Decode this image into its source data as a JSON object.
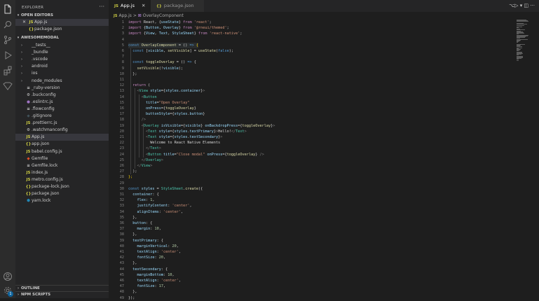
{
  "activity_bar": {
    "icons": [
      "explorer-icon",
      "search-icon",
      "source-control-icon",
      "run-debug-icon",
      "extensions-icon",
      "gitlens-icon",
      "accounts-icon",
      "settings-icon"
    ],
    "settings_badge": "1"
  },
  "sidebar": {
    "title": "EXPLORER",
    "more": "···",
    "open_editors": {
      "label": "OPEN EDITORS",
      "items": [
        {
          "icon": "JS",
          "icon_color": "#cbcb41",
          "name": "App.js",
          "hint": "",
          "close": "✕"
        },
        {
          "icon": "{}",
          "icon_color": "#cbcb41",
          "name": "package.json",
          "hint": "",
          "close": ""
        }
      ]
    },
    "project": {
      "label": "AWESOMEMODAL",
      "items": [
        {
          "chev": "›",
          "icon": "",
          "icon_color": "#cccccc",
          "name": "__tests__"
        },
        {
          "chev": "›",
          "icon": "",
          "icon_color": "#cccccc",
          "name": "_bundle"
        },
        {
          "chev": "›",
          "icon": "",
          "icon_color": "#cccccc",
          "name": ".vscode"
        },
        {
          "chev": "›",
          "icon": "",
          "icon_color": "#cccccc",
          "name": "android"
        },
        {
          "chev": "›",
          "icon": "",
          "icon_color": "#cccccc",
          "name": "ios"
        },
        {
          "chev": "›",
          "icon": "",
          "icon_color": "#cccccc",
          "name": "node_modules"
        },
        {
          "chev": "",
          "icon": "≡",
          "icon_color": "#cccccc",
          "name": "_ruby-version"
        },
        {
          "chev": "",
          "icon": "⚙",
          "icon_color": "#cccccc",
          "name": ".buckconfig"
        },
        {
          "chev": "",
          "icon": "●",
          "icon_color": "#a074c4",
          "name": ".eslintrc.js"
        },
        {
          "chev": "",
          "icon": "≡",
          "icon_color": "#cccccc",
          "name": ".flowconfig"
        },
        {
          "chev": "",
          "icon": "◆",
          "icon_color": "#41535b",
          "name": ".gitignore"
        },
        {
          "chev": "",
          "icon": "JS",
          "icon_color": "#cbcb41",
          "name": ".prettierrc.js"
        },
        {
          "chev": "",
          "icon": "⚙",
          "icon_color": "#cccccc",
          "name": ".watchmanconfig"
        },
        {
          "chev": "",
          "icon": "JS",
          "icon_color": "#cbcb41",
          "name": "App.js"
        },
        {
          "chev": "",
          "icon": "{}",
          "icon_color": "#cbcb41",
          "name": "app.json"
        },
        {
          "chev": "",
          "icon": "JS",
          "icon_color": "#cbcb41",
          "name": "babel.config.js"
        },
        {
          "chev": "",
          "icon": "◆",
          "icon_color": "#e44d26",
          "name": "Gemfile"
        },
        {
          "chev": "",
          "icon": "≡",
          "icon_color": "#cccccc",
          "name": "Gemfile.lock"
        },
        {
          "chev": "",
          "icon": "JS",
          "icon_color": "#cbcb41",
          "name": "index.js"
        },
        {
          "chev": "",
          "icon": "JS",
          "icon_color": "#cbcb41",
          "name": "metro.config.js"
        },
        {
          "chev": "",
          "icon": "{}",
          "icon_color": "#cbcb41",
          "name": "package-lock.json"
        },
        {
          "chev": "",
          "icon": "{}",
          "icon_color": "#cbcb41",
          "name": "package.json"
        },
        {
          "chev": "",
          "icon": "⬢",
          "icon_color": "#2188b6",
          "name": "yarn.lock"
        }
      ]
    },
    "outline_label": "OUTLINE",
    "npm_label": "NPM SCRIPTS"
  },
  "tabs": [
    {
      "icon": "JS",
      "label": "App.js",
      "close": "✕",
      "active": true
    },
    {
      "icon": "{}",
      "label": "package.json",
      "close": "",
      "active": false
    }
  ],
  "tab_actions": "⌥▷ ▾  ◫  ···",
  "breadcrumb": {
    "icon": "JS",
    "file": "App.js",
    "sep": ">",
    "symbol_icon": "⊠",
    "symbol": "OverlayComponent"
  },
  "code_lines": [
    [
      [
        "k",
        "import "
      ],
      [
        "w",
        "React, {"
      ],
      [
        "v",
        "useState"
      ],
      [
        "w",
        "} "
      ],
      [
        "k",
        "from "
      ],
      [
        "s",
        "'react'"
      ],
      [
        "w",
        ";"
      ]
    ],
    [
      [
        "k",
        "import "
      ],
      [
        "w",
        "{"
      ],
      [
        "v",
        "Button"
      ],
      [
        "w",
        ", "
      ],
      [
        "v",
        "Overlay"
      ],
      [
        "w",
        "} "
      ],
      [
        "k",
        "from "
      ],
      [
        "s",
        "'@rneui/themed'"
      ],
      [
        "w",
        ";"
      ]
    ],
    [
      [
        "k",
        "import "
      ],
      [
        "w",
        "{"
      ],
      [
        "v",
        "View"
      ],
      [
        "w",
        ", "
      ],
      [
        "v",
        "Text"
      ],
      [
        "w",
        ", "
      ],
      [
        "v",
        "StyleSheet"
      ],
      [
        "w",
        "} "
      ],
      [
        "k",
        "from "
      ],
      [
        "s",
        "'react-native'"
      ],
      [
        "w",
        ";"
      ]
    ],
    [],
    [
      [
        "b",
        "const "
      ],
      [
        "f",
        "OverlayComponent"
      ],
      [
        "w",
        " = () "
      ],
      [
        "b",
        "=>"
      ],
      [
        "w",
        " "
      ],
      [
        "y",
        "{"
      ]
    ],
    [
      [
        "w",
        "  "
      ],
      [
        "b",
        "const "
      ],
      [
        "w",
        "["
      ],
      [
        "v",
        "visible"
      ],
      [
        "w",
        ", "
      ],
      [
        "f",
        "setVisible"
      ],
      [
        "w",
        "] = "
      ],
      [
        "f",
        "useState"
      ],
      [
        "w",
        "("
      ],
      [
        "b",
        "false"
      ],
      [
        "w",
        ");"
      ]
    ],
    [],
    [
      [
        "w",
        "  "
      ],
      [
        "b",
        "const "
      ],
      [
        "f",
        "toggleOverlay"
      ],
      [
        "w",
        " = () "
      ],
      [
        "b",
        "=>"
      ],
      [
        "w",
        " {"
      ]
    ],
    [
      [
        "w",
        "    "
      ],
      [
        "f",
        "setVisible"
      ],
      [
        "w",
        "(!"
      ],
      [
        "v",
        "visible"
      ],
      [
        "w",
        ");"
      ]
    ],
    [
      [
        "w",
        "  };"
      ]
    ],
    [],
    [
      [
        "w",
        "  "
      ],
      [
        "k",
        "return "
      ],
      [
        "w",
        "("
      ]
    ],
    [
      [
        "w",
        "    "
      ],
      [
        "p",
        "<"
      ],
      [
        "t",
        "View "
      ],
      [
        "v",
        "style"
      ],
      [
        "w",
        "={"
      ],
      [
        "v",
        "styles"
      ],
      [
        "w",
        "."
      ],
      [
        "v",
        "container"
      ],
      [
        "w",
        "}"
      ],
      [
        "p",
        ">"
      ]
    ],
    [
      [
        "w",
        "      "
      ],
      [
        "p",
        "<"
      ],
      [
        "t",
        "Button"
      ]
    ],
    [
      [
        "w",
        "        "
      ],
      [
        "v",
        "title"
      ],
      [
        "w",
        "="
      ],
      [
        "s",
        "\"Open Overlay\""
      ]
    ],
    [
      [
        "w",
        "        "
      ],
      [
        "v",
        "onPress"
      ],
      [
        "w",
        "={"
      ],
      [
        "f",
        "toggleOverlay"
      ],
      [
        "w",
        "}"
      ]
    ],
    [
      [
        "w",
        "        "
      ],
      [
        "v",
        "buttonStyle"
      ],
      [
        "w",
        "={"
      ],
      [
        "v",
        "styles"
      ],
      [
        "w",
        "."
      ],
      [
        "v",
        "button"
      ],
      [
        "w",
        "}"
      ]
    ],
    [
      [
        "w",
        "      "
      ],
      [
        "p",
        "/>"
      ]
    ],
    [
      [
        "w",
        "      "
      ],
      [
        "p",
        "<"
      ],
      [
        "t",
        "Overlay "
      ],
      [
        "v",
        "isVisible"
      ],
      [
        "w",
        "={"
      ],
      [
        "v",
        "visible"
      ],
      [
        "w",
        "} "
      ],
      [
        "v",
        "onBackdropPress"
      ],
      [
        "w",
        "={"
      ],
      [
        "f",
        "toggleOverlay"
      ],
      [
        "w",
        "}"
      ],
      [
        "p",
        ">"
      ]
    ],
    [
      [
        "w",
        "        "
      ],
      [
        "p",
        "<"
      ],
      [
        "t",
        "Text "
      ],
      [
        "v",
        "style"
      ],
      [
        "w",
        "={"
      ],
      [
        "v",
        "styles"
      ],
      [
        "w",
        "."
      ],
      [
        "v",
        "textPrimary"
      ],
      [
        "w",
        "}"
      ],
      [
        "p",
        ">"
      ],
      [
        "w",
        "Hello!"
      ],
      [
        "p",
        "</"
      ],
      [
        "t",
        "Text"
      ],
      [
        "p",
        ">"
      ]
    ],
    [
      [
        "w",
        "        "
      ],
      [
        "p",
        "<"
      ],
      [
        "t",
        "Text "
      ],
      [
        "v",
        "style"
      ],
      [
        "w",
        "={"
      ],
      [
        "v",
        "styles"
      ],
      [
        "w",
        "."
      ],
      [
        "v",
        "textSecondary"
      ],
      [
        "w",
        "}"
      ],
      [
        "p",
        ">"
      ]
    ],
    [
      [
        "w",
        "          Welcome to React Native Elements"
      ]
    ],
    [
      [
        "w",
        "        "
      ],
      [
        "p",
        "</"
      ],
      [
        "t",
        "Text"
      ],
      [
        "p",
        ">"
      ]
    ],
    [
      [
        "w",
        "        "
      ],
      [
        "p",
        "<"
      ],
      [
        "t",
        "Button "
      ],
      [
        "v",
        "title"
      ],
      [
        "w",
        "="
      ],
      [
        "s",
        "\"Close modal\" "
      ],
      [
        "v",
        "onPress"
      ],
      [
        "w",
        "={"
      ],
      [
        "f",
        "toggleOverlay"
      ],
      [
        "w",
        "} "
      ],
      [
        "p",
        "/>"
      ]
    ],
    [
      [
        "w",
        "      "
      ],
      [
        "p",
        "</"
      ],
      [
        "t",
        "Overlay"
      ],
      [
        "p",
        ">"
      ]
    ],
    [
      [
        "w",
        "    "
      ],
      [
        "p",
        "</"
      ],
      [
        "t",
        "View"
      ],
      [
        "p",
        ">"
      ]
    ],
    [
      [
        "w",
        "  );"
      ]
    ],
    [
      [
        "y",
        "};"
      ]
    ],
    [],
    [
      [
        "b",
        "const "
      ],
      [
        "v",
        "styles"
      ],
      [
        "w",
        " = "
      ],
      [
        "t",
        "StyleSheet"
      ],
      [
        "w",
        "."
      ],
      [
        "f",
        "create"
      ],
      [
        "w",
        "({"
      ]
    ],
    [
      [
        "w",
        "  "
      ],
      [
        "v",
        "container"
      ],
      [
        "w",
        ": {"
      ]
    ],
    [
      [
        "w",
        "    "
      ],
      [
        "v",
        "flex"
      ],
      [
        "w",
        ": "
      ],
      [
        "n",
        "1"
      ],
      [
        "w",
        ","
      ]
    ],
    [
      [
        "w",
        "    "
      ],
      [
        "v",
        "justifyContent"
      ],
      [
        "w",
        ": "
      ],
      [
        "s",
        "'center'"
      ],
      [
        "w",
        ","
      ]
    ],
    [
      [
        "w",
        "    "
      ],
      [
        "v",
        "alignItems"
      ],
      [
        "w",
        ": "
      ],
      [
        "s",
        "'center'"
      ],
      [
        "w",
        ","
      ]
    ],
    [
      [
        "w",
        "  },"
      ]
    ],
    [
      [
        "w",
        "  "
      ],
      [
        "v",
        "button"
      ],
      [
        "w",
        ": {"
      ]
    ],
    [
      [
        "w",
        "    "
      ],
      [
        "v",
        "margin"
      ],
      [
        "w",
        ": "
      ],
      [
        "n",
        "10"
      ],
      [
        "w",
        ","
      ]
    ],
    [
      [
        "w",
        "  },"
      ]
    ],
    [
      [
        "w",
        "  "
      ],
      [
        "v",
        "textPrimary"
      ],
      [
        "w",
        ": {"
      ]
    ],
    [
      [
        "w",
        "    "
      ],
      [
        "v",
        "marginVertical"
      ],
      [
        "w",
        ": "
      ],
      [
        "n",
        "20"
      ],
      [
        "w",
        ","
      ]
    ],
    [
      [
        "w",
        "    "
      ],
      [
        "v",
        "textAlign"
      ],
      [
        "w",
        ": "
      ],
      [
        "s",
        "'center'"
      ],
      [
        "w",
        ","
      ]
    ],
    [
      [
        "w",
        "    "
      ],
      [
        "v",
        "fontSize"
      ],
      [
        "w",
        ": "
      ],
      [
        "n",
        "20"
      ],
      [
        "w",
        ","
      ]
    ],
    [
      [
        "w",
        "  },"
      ]
    ],
    [
      [
        "w",
        "  "
      ],
      [
        "v",
        "textSecondary"
      ],
      [
        "w",
        ": {"
      ]
    ],
    [
      [
        "w",
        "    "
      ],
      [
        "v",
        "marginBottom"
      ],
      [
        "w",
        ": "
      ],
      [
        "n",
        "10"
      ],
      [
        "w",
        ","
      ]
    ],
    [
      [
        "w",
        "    "
      ],
      [
        "v",
        "textAlign"
      ],
      [
        "w",
        ": "
      ],
      [
        "s",
        "'center'"
      ],
      [
        "w",
        ","
      ]
    ],
    [
      [
        "w",
        "    "
      ],
      [
        "v",
        "fontSize"
      ],
      [
        "w",
        ": "
      ],
      [
        "n",
        "17"
      ],
      [
        "w",
        ","
      ]
    ],
    [
      [
        "w",
        "  },"
      ]
    ],
    [
      [
        "w",
        "});"
      ]
    ]
  ]
}
